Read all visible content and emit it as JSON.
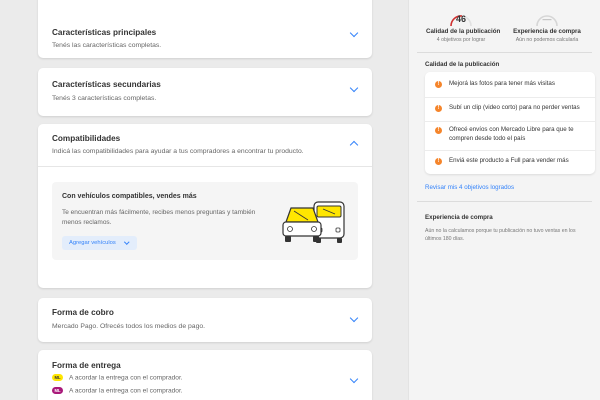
{
  "main": {
    "sections": [
      {
        "title": "Características principales",
        "subtitle": "Tenés las características completas."
      },
      {
        "title": "Características secundarias",
        "subtitle": "Tenés 3 características completas."
      },
      {
        "title": "Compatibilidades",
        "subtitle": "Indicá las compatibilidades para ayudar a tus compradores a encontrar tu producto."
      },
      {
        "title": "Forma de cobro",
        "subtitle": "Mercado Pago. Ofrecés todos los medios de pago."
      },
      {
        "title": "Forma de entrega",
        "subtitle": ""
      }
    ],
    "compat_box": {
      "title": "Con vehículos compatibles, vendes más",
      "description": "Te encuentran más fácilmente, recibes menos preguntas y también menos reclamos.",
      "button": "Agregar vehículos"
    },
    "shipping": [
      {
        "badge": "ML",
        "badge_color": "#ffe600",
        "badge_text_color": "#333333",
        "text": "A acordar la entrega con el comprador."
      },
      {
        "badge": "ML",
        "badge_color": "#a9197a",
        "badge_text_color": "#ffffff",
        "text": "A acordar la entrega con el comprador."
      }
    ]
  },
  "sidebar": {
    "quality": {
      "value": "46",
      "label": "Calidad de la publicación",
      "sub": "4 objetivos por lograr",
      "color": "#d0302f"
    },
    "experience": {
      "value": "—",
      "label": "Experiencia de compra",
      "sub": "Aún no podemos calcularla"
    },
    "quality_title": "Calidad de la publicación",
    "tips": [
      "Mejorá las fotos para tener más visitas",
      "Subí un clip (video corto) para no perder ventas",
      "Ofrecé envíos con Mercado Libre para que te compren desde todo el país",
      "Enviá este producto a Full para vender más"
    ],
    "review_link": "Revisar mis 4 objetivos logrados",
    "experience_title": "Experiencia de compra",
    "experience_text": "Aún no la calculamos porque tu publicación no tuvo ventas en los últimos 180 días."
  },
  "colors": {
    "accent": "#3483fa",
    "warning": "#f5852b",
    "quality_arc": "#d0302f"
  },
  "icons": [
    "chevron-down-icon",
    "chevron-up-icon",
    "warning-icon",
    "cars-illustration"
  ]
}
